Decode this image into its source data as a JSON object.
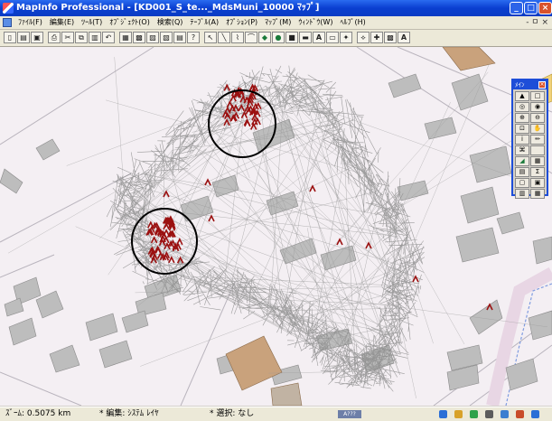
{
  "window": {
    "title": "MapInfo Professional - [KD001_S_te..._MdsMuni_10000 ﾏｯﾌﾟ]",
    "controls": [
      "_",
      "□",
      "×"
    ]
  },
  "menu": {
    "items": [
      "ﾌｧｲﾙ(F)",
      "編集(E)",
      "ﾂｰﾙ(T)",
      "ｵﾌﾞｼﾞｪｸﾄ(O)",
      "検索(Q)",
      "ﾃｰﾌﾞﾙ(A)",
      "ｵﾌﾟｼｮﾝ(P)",
      "ﾏｯﾌﾟ(M)",
      "ｳｨﾝﾄﾞｳ(W)",
      "ﾍﾙﾌﾟ(H)"
    ],
    "mdi_controls": "- ㅁ ×"
  },
  "toolbar": {
    "icons": [
      "new-icon",
      "open-icon",
      "save-icon",
      "print-icon",
      "cut-icon",
      "copy-icon",
      "paste-icon",
      "undo-icon",
      "new-browser-icon",
      "new-map-icon",
      "new-graph-icon",
      "new-layout-icon",
      "new-redistrict-icon",
      "help-icon",
      "select-icon",
      "line-icon",
      "polyline-icon",
      "arc-icon",
      "polygon-icon",
      "ellipse-icon",
      "rectangle-icon",
      "rounded-rect-icon",
      "text-icon",
      "frame-icon",
      "symbol-icon",
      "reshape-icon",
      "add-node-icon",
      "styles-icon",
      "text-style-icon"
    ],
    "text_tool": "A"
  },
  "palette": {
    "title": "ﾒｲﾝ",
    "tools": [
      "▲",
      "□",
      "◎",
      "◉",
      "⊕",
      "⊖",
      "⊡",
      "✋",
      "i",
      "✏",
      "⌘",
      "",
      "◢",
      "▦",
      "▤",
      "Σ",
      "▢",
      "▣",
      "▥",
      "▦"
    ]
  },
  "status": {
    "zoom": "ｽﾞｰﾑ: 0.5075 km",
    "editing": "* 編集: ｼｽﾃﾑ ﾚｲﾔ",
    "selection": "* 選択: なし"
  },
  "tray": {
    "label": "A???",
    "icons": [
      "ie-icon",
      "mail-icon",
      "messenger-icon",
      "volume-icon",
      "network-icon",
      "security-icon",
      "clock-icon"
    ]
  },
  "colors": {
    "map_background": "#f4eff3",
    "building": "#bdbdbd",
    "building_brown": "#c9a27c",
    "track": "#8c8c8c",
    "marker": "#9b1010",
    "selection_blue": "#1e4ed8"
  }
}
